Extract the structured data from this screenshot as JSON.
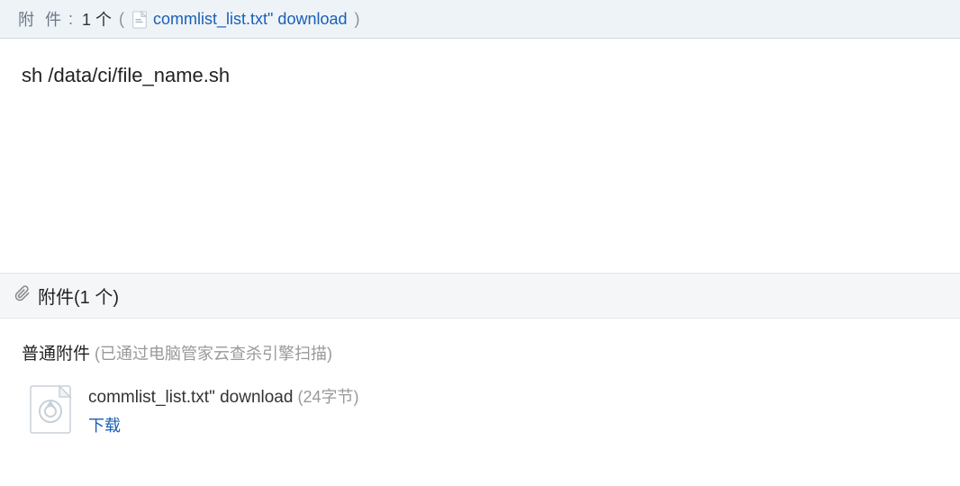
{
  "header": {
    "label": "附件",
    "colon": ":",
    "count": "1 个",
    "paren_open": "(",
    "file_link": "commlist_list.txt\" download",
    "paren_close": ")"
  },
  "body": {
    "command": "sh /data/ci/file_name.sh"
  },
  "section": {
    "title": "附件",
    "count": "(1 个)",
    "category_label": "普通附件",
    "category_note": "(已通过电脑管家云查杀引擎扫描)"
  },
  "attachment": {
    "name": "commlist_list.txt\" download",
    "size": "(24字节)",
    "download_label": "下载"
  }
}
